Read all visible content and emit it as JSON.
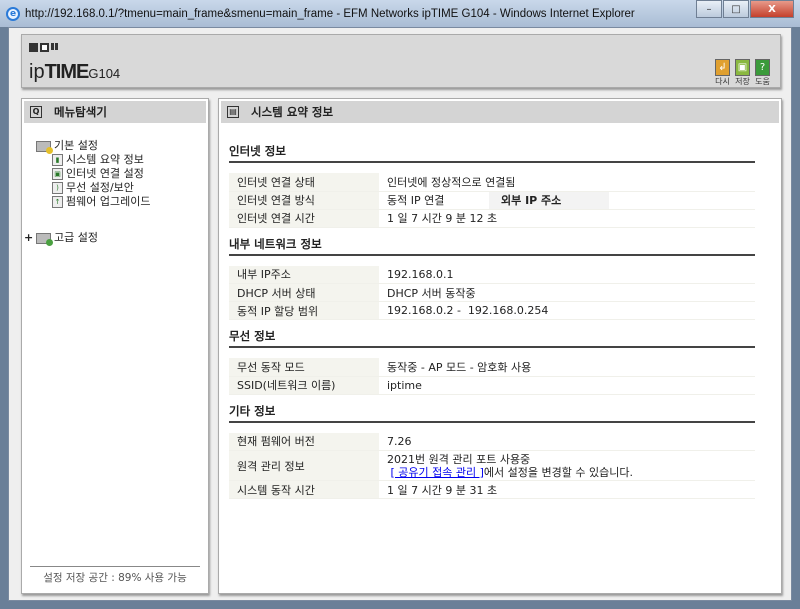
{
  "window": {
    "title": "http://192.168.0.1/?tmenu=main_frame&smenu=main_frame - EFM Networks ipTIME G104 - Windows Internet Explorer",
    "min": "–",
    "max": "□",
    "close": "X"
  },
  "header": {
    "logo_bold": "TIME",
    "logo_prefix": "ip",
    "model": "G104",
    "tools": [
      {
        "label": "다시",
        "icon": "↲",
        "color": "#e0a030"
      },
      {
        "label": "저장",
        "icon": "▣",
        "color": "#8ab840"
      },
      {
        "label": "도움",
        "icon": "?",
        "color": "#3a9a3a"
      }
    ]
  },
  "sidebar": {
    "title": "메뉴탐색기",
    "groups": [
      {
        "label": "기본 설정",
        "items": [
          "시스템 요약 정보",
          "인터넷 연결 설정",
          "무선 설정/보안",
          "펌웨어 업그레이드"
        ]
      },
      {
        "label": "고급 설정",
        "expander": "+"
      }
    ],
    "footer": "설정 저장 공간 : 89% 사용 가능"
  },
  "main": {
    "title": "시스템 요약 정보",
    "internet": {
      "title": "인터넷 정보",
      "rows": [
        [
          "인터넷 연결 상태",
          "인터넷에 정상적으로 연결됨"
        ],
        [
          "인터넷 연결 방식",
          "동적 IP 연결"
        ],
        [
          "인터넷 연결 시간",
          "1 일 7 시간 9 분 12 초"
        ]
      ],
      "external_ip_label": "외부 IP 주소"
    },
    "lan": {
      "title": "내부 네트워크 정보",
      "rows": [
        [
          "내부 IP주소",
          "192.168.0.1"
        ],
        [
          "DHCP 서버 상태",
          "DHCP 서버 동작중"
        ],
        [
          "동적 IP 할당 범위",
          "192.168.0.2 -  192.168.0.254"
        ]
      ]
    },
    "wireless": {
      "title": "무선 정보",
      "rows": [
        [
          "무선 동작 모드",
          "동작중 - AP 모드 - 암호화 사용"
        ],
        [
          "SSID(네트워크 이름)",
          "iptime"
        ]
      ]
    },
    "etc": {
      "title": "기타 정보",
      "fw_label": "현재 펌웨어 버전",
      "fw": "7.26",
      "remote_label": "원격 관리 정보",
      "remote_line1": "2021번 원격 관리 포트 사용중",
      "remote_link": "[ 공유기 접속 관리 ]",
      "remote_line2": "에서 설정을 변경할 수 있습니다.",
      "uptime_label": "시스템 동작 시간",
      "uptime": "1 일 7 시간 9 분 31 초"
    }
  }
}
